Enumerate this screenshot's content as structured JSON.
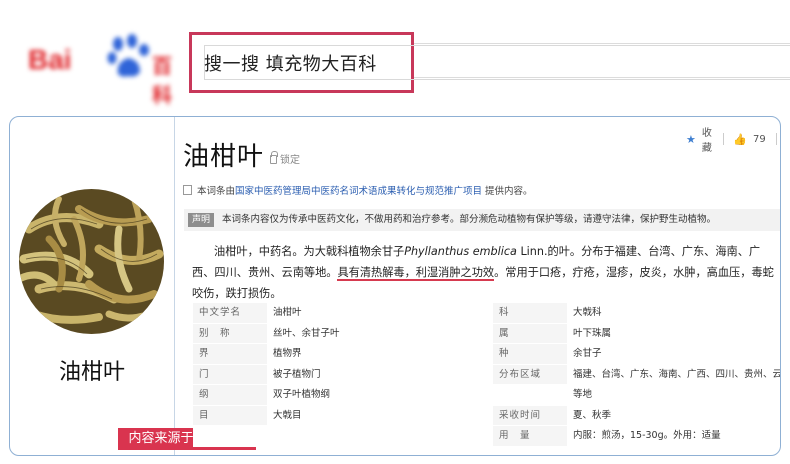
{
  "logo": {
    "bai": "Bai",
    "baike": "百科",
    "paw_color": "#2f64d8",
    "brand_color": "#e0262b"
  },
  "search": {
    "query": "搜一搜  填充物大百科",
    "highlight_color": "#c8385a"
  },
  "entry": {
    "title": "油柑叶",
    "lock_label": "锁定",
    "actions": {
      "favorite_label": "收藏",
      "like_count": "79"
    },
    "source_prefix": "本词条由",
    "source_link": "国家中医药管理局中医药名词术语成果转化与规范推广项目",
    "source_suffix": " 提供内容。",
    "notice_tag": "声明",
    "notice_text": "本词条内容仅为传承中医药文化，不做用药和治疗参考。部分濒危动植物有保护等级，请遵守法律，保护野生动植物。",
    "intro_part1": "油柑叶，中药名。为大戟科植物余甘子",
    "intro_latin": "Phyllanthus emblica",
    "intro_part2": " Linn.的叶。分布于福建、台湾、广东、海南、广西、四川、贵州、云南等地。",
    "intro_highlight": "具有清热解毒，利湿消肿之功效",
    "intro_part3": "。常用于口疮，疔疮，湿疹，皮炎，水肿，高血压，毒蛇咬伤，跌打损伤。",
    "underline_color": "#d63a4f"
  },
  "info_rows": [
    {
      "k": "中文学名",
      "v": "油柑叶",
      "k2": "科",
      "v2": "大戟科"
    },
    {
      "k": "别　称",
      "v": "丝叶、余甘子叶",
      "k2": "属",
      "v2": "叶下珠属"
    },
    {
      "k": "界",
      "v": "植物界",
      "k2": "种",
      "v2": "余甘子"
    },
    {
      "k": "门",
      "v": "被子植物门",
      "k2": "分布区域",
      "v2": "福建、台湾、广东、海南、广西、四川、贵州、云南"
    },
    {
      "k": "纲",
      "v": "双子叶植物纲",
      "k2": "",
      "v2": "等地"
    },
    {
      "k": "目",
      "v": "大戟目",
      "k2": "采收时间",
      "v2": "夏、秋季"
    },
    {
      "k": "",
      "v": "",
      "k2": "用　量",
      "v2": "内服：煎汤，15-30g。外用：适量"
    }
  ],
  "left_panel": {
    "caption": "油柑叶",
    "source_badge": "内容来源于百度百科",
    "badge_color": "#d9344f"
  }
}
